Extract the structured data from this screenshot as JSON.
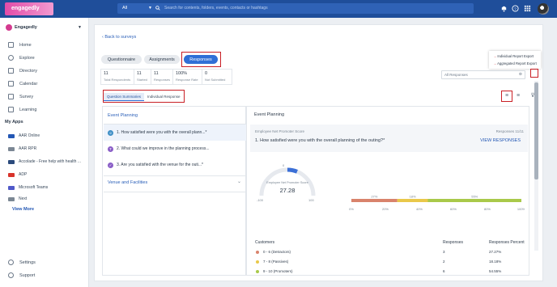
{
  "header": {
    "logo_text": "engagedly",
    "search_scope": "All",
    "search_placeholder": "Search for contents, folders, events, contacts or hashtags"
  },
  "sidebar": {
    "org_name": "Engagedly",
    "items": [
      {
        "label": "Home"
      },
      {
        "label": "Explore"
      },
      {
        "label": "Directory"
      },
      {
        "label": "Calendar"
      },
      {
        "label": "Survey"
      },
      {
        "label": "Learning"
      }
    ],
    "myapps_title": "My Apps",
    "apps": [
      {
        "label": "AAR Online",
        "color": "#2357b4"
      },
      {
        "label": "AAR RPR",
        "color": "#7b8794"
      },
      {
        "label": "Accolade - Free help with health ...",
        "color": "#2b4a7c"
      },
      {
        "label": "ADP",
        "color": "#d8332b"
      },
      {
        "label": "Microsoft Teams",
        "color": "#5059c9"
      },
      {
        "label": "Next",
        "color": "#7b8794"
      }
    ],
    "view_more": "View More",
    "footer": [
      {
        "label": "Settings"
      },
      {
        "label": "Support"
      }
    ]
  },
  "main": {
    "back_link": "Back to surveys",
    "tabs": [
      {
        "label": "Questionnaire"
      },
      {
        "label": "Assignments"
      },
      {
        "label": "Responses"
      }
    ],
    "stats": [
      {
        "value": "11",
        "label": "Total Respondents"
      },
      {
        "value": "11",
        "label": "Started"
      },
      {
        "value": "11",
        "label": "Responses"
      },
      {
        "value": "100%",
        "label": "Response Rate"
      },
      {
        "value": "0",
        "label": "Not Submitted"
      }
    ],
    "filter_value": "All Responses",
    "export_menu": [
      "Individual Report Export",
      "Aggregated Report Export"
    ],
    "subtabs": [
      "Question Summaries",
      "Individual Response"
    ],
    "sections": [
      {
        "title": "Event Planning",
        "questions": [
          {
            "label": "1. How satisfied were you with the overall plann...*",
            "icon_color": "#3f8fc6",
            "icon": "☺"
          },
          {
            "label": "2. What could we improve in the planning process...",
            "icon_color": "#8a5ec7",
            "icon": "T"
          },
          {
            "label": "3. Are you satisfied with the venue for the outi...*",
            "icon_color": "#8a5ec7",
            "icon": "✓"
          }
        ]
      },
      {
        "title": "Venue and Facilities",
        "questions": []
      }
    ],
    "detail": {
      "section_title": "Event Planning",
      "question_type": "Employee Net Promoter Score",
      "responses_count": "Responses 11/11",
      "question_text": "1. How satisfied were you with the overall planning of the outing?*",
      "view_link": "VIEW RESPONSES",
      "gauge": {
        "label": "Employee Net Promoter Score",
        "value": "27.28",
        "min": "-100",
        "max": "100",
        "top": "0"
      },
      "bar": {
        "segments": [
          {
            "label": "27%",
            "value": 27,
            "color": "#d9836c"
          },
          {
            "label": "18%",
            "value": 18,
            "color": "#e9c84a"
          },
          {
            "label": "55%",
            "value": 55,
            "color": "#a9c94a"
          }
        ],
        "ticks": [
          "0%",
          "20%",
          "40%",
          "60%",
          "80%",
          "100%"
        ]
      },
      "table": {
        "headers": [
          "Customers",
          "Responses",
          "Responses Percent"
        ],
        "rows": [
          {
            "label": "0 - 6 (Detractors)",
            "responses": "3",
            "percent": "27.27%",
            "color": "#d9836c"
          },
          {
            "label": "7 - 8 (Passives)",
            "responses": "2",
            "percent": "18.18%",
            "color": "#e9c84a"
          },
          {
            "label": "9 - 10 (Promoters)",
            "responses": "6",
            "percent": "54.55%",
            "color": "#a9c94a"
          }
        ]
      }
    }
  }
}
